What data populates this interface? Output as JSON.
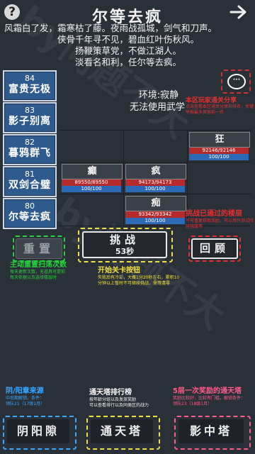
{
  "header": {
    "help_icon": "?",
    "title": "尔等去疯"
  },
  "poem": [
    "风霜白了发，霜寒枯了藤。夜雨战孤城，剑气和刀声。",
    "侠骨千年寻不见，碧血红叶伤秋风。",
    "扬鞭策草党，不做江湖人。",
    "淡看名和利，任尔等去疯。"
  ],
  "floors": [
    {
      "num": "84",
      "name": "富贵无极"
    },
    {
      "num": "83",
      "name": "影子别离"
    },
    {
      "num": "82",
      "name": "暮鸦群飞"
    },
    {
      "num": "81",
      "name": "双剑合璧"
    },
    {
      "num": "80",
      "name": "尔等去疯"
    }
  ],
  "environment": {
    "label": "环境:寂静",
    "status": "无法使用武学"
  },
  "share_note": {
    "title": "本区玩家通关分享",
    "sub": "点击查看本区通关分享和排名，关键举报最多保留前一名"
  },
  "monsters": [
    {
      "name": "狂",
      "hp": "92146/92146",
      "mp": "100/100"
    },
    {
      "name": "癫",
      "hp": "89550/89550",
      "mp": "100/100"
    },
    {
      "name": "疯",
      "hp": "94173/94173",
      "mp": "100/100"
    },
    {
      "name": "痴",
      "hp": "93342/93342",
      "mp": "100/100"
    }
  ],
  "passed_note": {
    "title": "挑战已通过的楼层",
    "sub": "不可重复获取奖励，可以用作测试阵容强度等"
  },
  "buttons": {
    "reset": "重置",
    "challenge": "挑战",
    "challenge_timer": "53秒",
    "review": "回顾"
  },
  "reset_note": {
    "title": "主动重置扫荡次数",
    "line1": "每天更新次数，无道具可提前",
    "line2": "每天依据以及选择楼层时"
  },
  "start_note": {
    "title": "开始关卡按钮",
    "line1": "失败后有冷却，大概1分20秒左右，累积10",
    "line2": "分钟以上暂时不可继续挑战，需等清零"
  },
  "source_note": {
    "title": "阴/阳章来源",
    "line1": "中后期解锁。条件：",
    "line2": "领队21（17级1月）"
  },
  "rank_note": {
    "title": "通天塔排行榜",
    "line1": "按年龄分组以及发放奖励",
    "line2": "可以查看排行以及同类区的战力"
  },
  "reward_note": {
    "title": "5层一次奖励的通天塔",
    "line1": "奖励比较好，比较有门槛，解锁条件：",
    "line2": "领队23（18级1月）"
  },
  "bottom_nav": [
    {
      "label": "阴阳隙"
    },
    {
      "label": "通天塔"
    },
    {
      "label": "影中塔"
    }
  ],
  "colors": {
    "background": "#2a3038",
    "floor_button": "#2f5a8e",
    "hp": "#b52b2b",
    "mp": "#2c6ab8",
    "green": "#27d13a",
    "blue": "#3aa8ff",
    "yellow": "#f0e040",
    "red": "#e23030",
    "pink": "#ff5a8a"
  }
}
